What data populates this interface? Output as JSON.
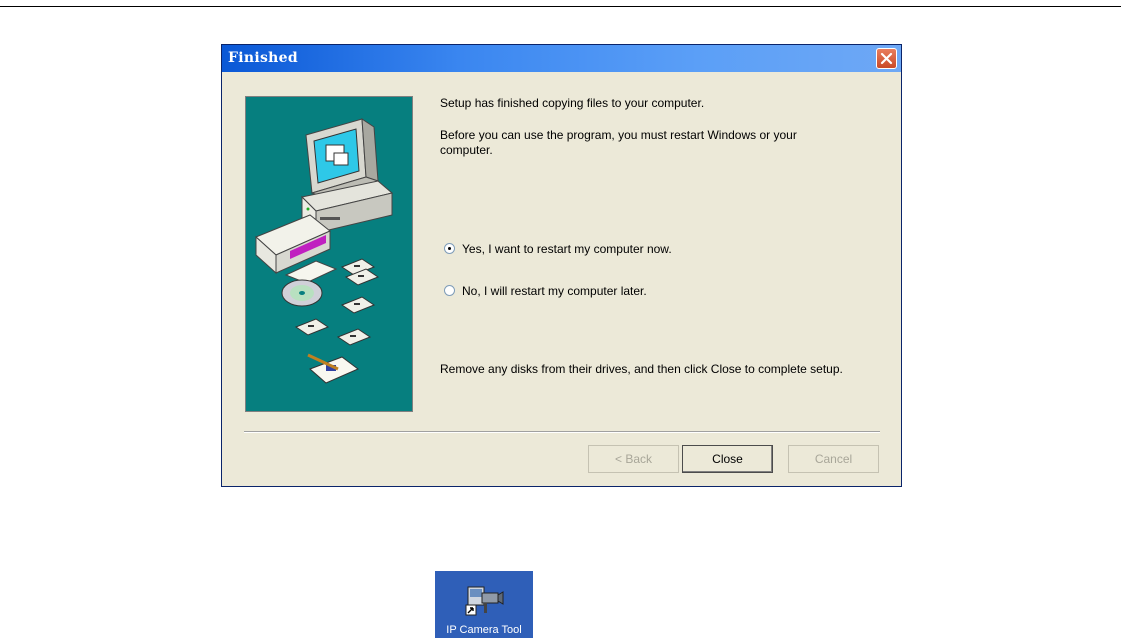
{
  "dialog": {
    "title": "Finished",
    "message_1": "Setup has finished copying files to your computer.",
    "message_2_line1": "Before you can use the program, you must restart Windows or your",
    "message_2_line2": "computer.",
    "option_restart_now": "Yes, I want to restart my computer now.",
    "option_restart_later": "No, I will restart my computer later.",
    "selected_option": "restart_now",
    "message_3": "Remove any disks from their drives, and then click Close to complete setup.",
    "buttons": {
      "back": "< Back",
      "close": "Close",
      "cancel": "Cancel"
    },
    "colors": {
      "title_bar": "#0a58d6",
      "body": "#ece9d8",
      "art_background": "#067f7f"
    }
  },
  "desktop": {
    "icon_label": "IP Camera Tool",
    "icon_name": "ip-camera-tool-icon"
  }
}
